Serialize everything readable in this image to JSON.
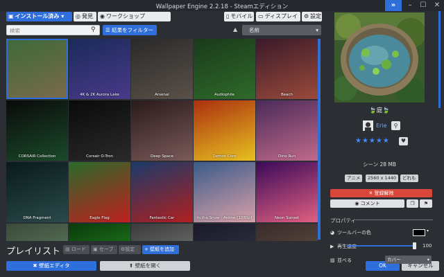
{
  "window": {
    "title": "Wallpaper Engine 2.2.18 - Steamエディション",
    "expand_label": "»",
    "minimize_label": "–",
    "maximize_label": "☐",
    "close_label": "✕"
  },
  "toolbar": {
    "installed_label": "インストール済み",
    "discover_label": "発見",
    "workshop_label": "ワークショップ",
    "mobile_label": "モバイル",
    "display_label": "ディスプレイ",
    "settings_label": "設定"
  },
  "search": {
    "placeholder": "検索",
    "filter_label": "結果をフィルター",
    "sort_label": "名前"
  },
  "grid": {
    "items": [
      {
        "label": "",
        "colors": [
          "#3d6a3a",
          "#7a6a4a"
        ]
      },
      {
        "label": "4K & 2K Aurora Lake",
        "colors": [
          "#1a2a5a",
          "#4a3a8a"
        ]
      },
      {
        "label": "Arsenal",
        "colors": [
          "#2a2a2a",
          "#5a5048"
        ]
      },
      {
        "label": "Audiophile",
        "colors": [
          "#1a3a1a",
          "#2f6a2a"
        ]
      },
      {
        "label": "Beach",
        "colors": [
          "#3a1a2a",
          "#9a4a3a"
        ]
      },
      {
        "label": "CORSAIR Collection",
        "colors": [
          "#0a0a0a",
          "#1a4a2a"
        ]
      },
      {
        "label": "Corsair O-Tron",
        "colors": [
          "#0a0a0a",
          "#2a2a2a"
        ]
      },
      {
        "label": "Deep Space",
        "colors": [
          "#2a1a1a",
          "#7a5a5a"
        ]
      },
      {
        "label": "Demon Core",
        "colors": [
          "#aa3010",
          "#e8c020"
        ]
      },
      {
        "label": "Dino Run",
        "colors": [
          "#4a2a5a",
          "#c06a8a"
        ]
      },
      {
        "label": "DNA Fragment",
        "colors": [
          "#0a1a1a",
          "#2a4a4a"
        ]
      },
      {
        "label": "Eagle Flag",
        "colors": [
          "#2a6a2a",
          "#c02020"
        ]
      },
      {
        "label": "Fantastic Car",
        "colors": [
          "#1a3a6a",
          "#b02020"
        ]
      },
      {
        "label": "In the Snow - Anime [1080p]",
        "colors": [
          "#3a5a8a",
          "#d8a0a8"
        ]
      },
      {
        "label": "Neon Sunset",
        "colors": [
          "#3a0a5a",
          "#e06080"
        ]
      },
      {
        "label": "",
        "colors": [
          "#3a4a3a",
          "#6a8a6a"
        ]
      },
      {
        "label": "",
        "colors": [
          "#0a3a0a",
          "#2a9a2a"
        ]
      },
      {
        "label": "",
        "colors": [
          "#3a3a3a",
          "#8a8a8a"
        ]
      },
      {
        "label": "",
        "colors": [
          "#1a1a2a",
          "#3a3a4a"
        ]
      },
      {
        "label": "",
        "colors": [
          "#3a2a2a",
          "#6a5a4a"
        ]
      }
    ]
  },
  "playlist": {
    "title": "プレイリスト",
    "load_label": "ロード",
    "save_label": "セーブ",
    "settings_label": "設定",
    "add_label": "壁紙を追加"
  },
  "footer": {
    "editor_label": "壁紙エディタ",
    "open_label": "壁紙を開く",
    "ok_label": "OK",
    "cancel_label": "キャンセル"
  },
  "details": {
    "title": "🍃庭🍃",
    "author": "Erie",
    "rating": "★★★★★",
    "size": "シーン 28 MB",
    "tags": [
      "アニメ",
      "2560 x 1440",
      "どれも"
    ],
    "unsubscribe_label": "✕ 登録解除",
    "comment_label": "コメント",
    "properties_label": "プロパティ",
    "color_label": "ツールバーの色",
    "speed_label": "再生速度",
    "speed_value": "100",
    "speed_fraction": 1.0,
    "align_label": "並べる",
    "align_value": "カバー"
  }
}
